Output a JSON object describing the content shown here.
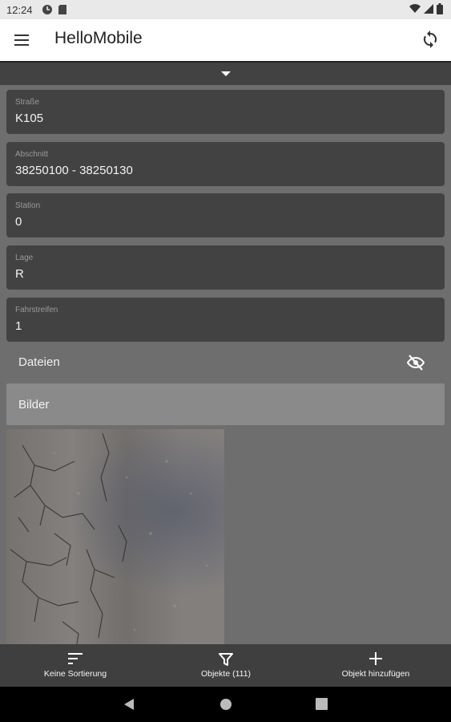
{
  "status_bar": {
    "time": "12:24",
    "icons_left": [
      "data-saver-icon",
      "sd-card-icon"
    ],
    "icons_right": [
      "wifi-icon",
      "signal-icon",
      "battery-icon"
    ]
  },
  "app_bar": {
    "title": "HelloMobile",
    "menu_icon": "menu-icon",
    "sync_icon": "sync-icon"
  },
  "form": {
    "fields": [
      {
        "label": "Straße",
        "value": "K105"
      },
      {
        "label": "Abschnitt",
        "value": "38250100 - 38250130"
      },
      {
        "label": "Station",
        "value": "0"
      },
      {
        "label": "Lage",
        "value": "R"
      },
      {
        "label": "Fahrstreifen",
        "value": "1"
      }
    ]
  },
  "sections": {
    "dateien": "Dateien",
    "dateien_icon": "visibility-off-icon",
    "bilder": "Bilder"
  },
  "bottom_bar": {
    "sort": "Keine Sortierung",
    "filter": "Objekte (111)",
    "add": "Objekt hinzufügen"
  },
  "colors": {
    "background": "#6e6e6e",
    "field_bg": "#424242",
    "app_bar_bg": "#ffffff",
    "bottom_bar_bg": "#3f3f3f"
  }
}
